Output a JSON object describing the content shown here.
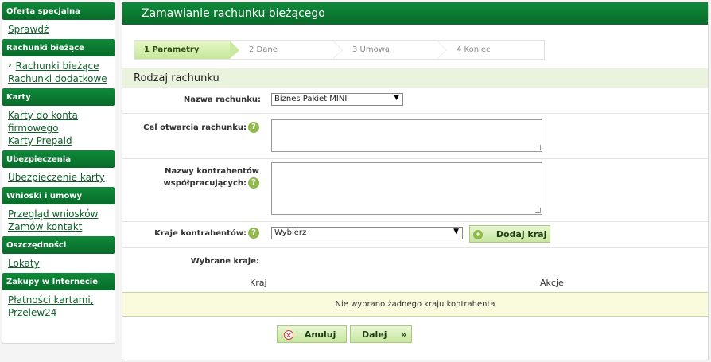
{
  "sidebar": {
    "sections": [
      {
        "title": "Oferta specjalna",
        "links": [
          "Sprawdź"
        ]
      },
      {
        "title": "Rachunki bieżące",
        "links": [
          "Rachunki bieżące",
          "Rachunki dodatkowe"
        ]
      },
      {
        "title": "Karty",
        "links": [
          "Karty do konta firmowego",
          "Karty Prepaid"
        ]
      },
      {
        "title": "Ubezpieczenia",
        "links": [
          "Ubezpieczenie karty"
        ]
      },
      {
        "title": "Wnioski i umowy",
        "links": [
          "Przegląd wniosków",
          "Zamów kontakt"
        ]
      },
      {
        "title": "Oszczędności",
        "links": [
          "Lokaty"
        ]
      },
      {
        "title": "Zakupy w Internecie",
        "links": [
          "Płatności kartami, Przelew24"
        ]
      }
    ],
    "active_marker": "›"
  },
  "main": {
    "title": "Zamawianie rachunku bieżącego",
    "steps": [
      "1 Parametry",
      "2 Dane",
      "3 Umowa",
      "4 Koniec"
    ],
    "section_title": "Rodzaj rachunku",
    "fields": {
      "account_name_label": "Nazwa rachunku:",
      "account_name_value": "Biznes Pakiet MINI",
      "purpose_label": "Cel otwarcia rachunku:",
      "contractors_label_1": "Nazwy kontrahentów",
      "contractors_label_2": "współpracujących:",
      "countries_label": "Kraje kontrahentów:",
      "countries_value": "Wybierz",
      "add_country_button": "Dodaj kraj",
      "selected_countries_label": "Wybrane kraje:"
    },
    "table": {
      "col_country": "Kraj",
      "col_actions": "Akcje",
      "empty_message": "Nie wybrano żadnego kraju kontrahenta"
    },
    "buttons": {
      "cancel": "Anuluj",
      "next": "Dalej"
    },
    "help_glyph": "?"
  },
  "colors": {
    "header_green": "#0f8a3a",
    "light_green": "#c7e69f",
    "section_bg": "#e9f3de"
  }
}
